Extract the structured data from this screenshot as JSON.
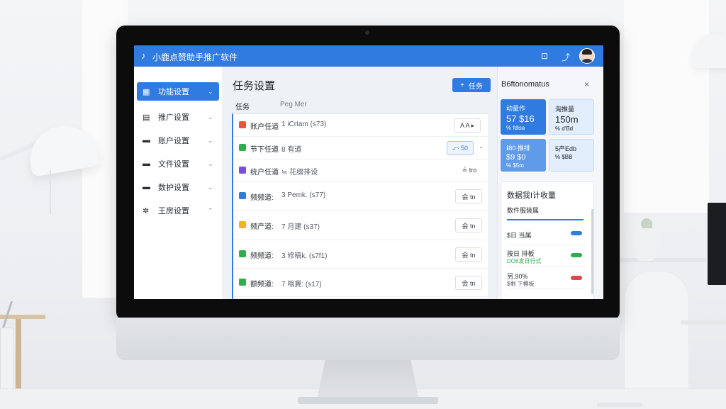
{
  "app": {
    "logo_glyph": "♪",
    "title": "小鹿点赞助手推广软件",
    "settings_glyph": "⊡",
    "edit_glyph": "⤴"
  },
  "sidebar": {
    "items": [
      {
        "icon": "▦",
        "label": "功能设置",
        "chevron": "⌄",
        "active": true
      },
      {
        "icon": "▤",
        "label": "推广设置",
        "chevron": "⌄"
      },
      {
        "icon": "▬",
        "label": "账户设置",
        "chevron": "⌄"
      },
      {
        "icon": "▬",
        "label": "文件设置",
        "chevron": "⌄"
      },
      {
        "icon": "▬",
        "label": "数护设置",
        "chevron": "⌄"
      },
      {
        "icon": "✲",
        "label": "王房设置",
        "chevron": "⌃"
      }
    ]
  },
  "main": {
    "title": "任务设置",
    "add_button": {
      "icon": "+",
      "label": "任务"
    },
    "tabs": {
      "active": "任务",
      "inactive": "Peg Mer"
    },
    "tasks": [
      {
        "badge": "●",
        "badge_color": "#e8553d",
        "name": "账户任道",
        "detail": "1 iCrtam (s73)",
        "action": "A A ▸",
        "style": "normal"
      },
      {
        "badge": "▼",
        "badge_color": "#2fae4f",
        "name": "节下任道",
        "detail": "8 有道",
        "action": "⤺ 50",
        "style": "blue",
        "caret": "⌄"
      },
      {
        "badge": "●",
        "badge_color": "#7b4de0",
        "name": "统户任道",
        "detail": "≒ 花缀排设",
        "action": "≟ tro",
        "style": "text"
      },
      {
        "badge": "●",
        "badge_color": "#2f7be0",
        "name": "频频道:",
        "detail": "3 Pemk. (s77)",
        "action": "会 tn",
        "style": "normal"
      },
      {
        "badge": "●",
        "badge_color": "#f0b323",
        "name": "频产道:",
        "detail": "7 月建 (s37)",
        "action": "会 tn",
        "style": "normal"
      },
      {
        "badge": "●",
        "badge_color": "#2fae4f",
        "name": "频频道:",
        "detail": "3 修稿k. (s7f1)",
        "action": "会 tn",
        "style": "normal"
      },
      {
        "badge": "●",
        "badge_color": "#2fae4f",
        "name": "额频道:",
        "detail": "7 嗡冀: (s17)",
        "action": "会 tn",
        "style": "normal"
      }
    ]
  },
  "right_panel": {
    "title": "B6ftonomatus",
    "close": "×",
    "stats": [
      {
        "label": "动量作",
        "value": "57 $16",
        "sub": "% fdisa",
        "style": "blue"
      },
      {
        "label": "淘推量",
        "value": "150m",
        "sub": "% d'Bd",
        "style": "light"
      },
      {
        "label": "ℹ80 推排",
        "value": "$9 $0",
        "sub": "% $5m",
        "style": "mid"
      },
      {
        "label": "5产Edb",
        "value": "",
        "sub": "% $BB",
        "style": "light"
      }
    ],
    "card": {
      "title": "数据我I计收量",
      "subtitle": "数件服装属",
      "items": [
        {
          "label": "$日 当属",
          "sub": "",
          "toggle_color": "#2f7be0"
        },
        {
          "label": "按日 排板",
          "sub": "DO6发日行式",
          "sub_color": "#2fae4f",
          "toggle_color": "#2fae4f"
        },
        {
          "label": "另.90%",
          "sub": "$剩 下模板",
          "sub_color": "#555b64",
          "toggle_color": "#e04848"
        }
      ]
    }
  }
}
